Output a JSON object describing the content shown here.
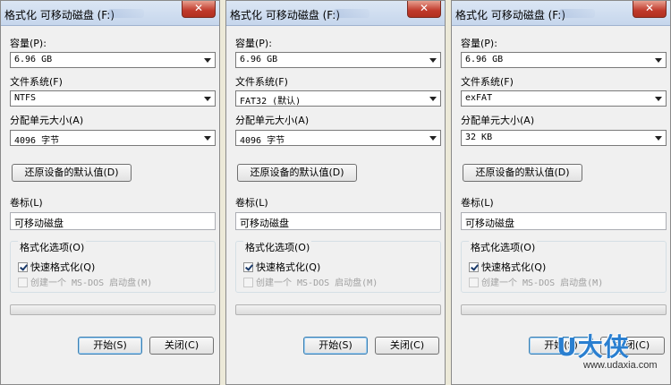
{
  "dialogs": [
    {
      "title": "格式化 可移动磁盘 (F:)",
      "capacity_label": "容量(P):",
      "capacity_value": "6.96 GB",
      "filesystem_label": "文件系统(F)",
      "filesystem_value": "NTFS",
      "alloc_label": "分配单元大小(A)",
      "alloc_value": "4096 字节",
      "restore_button": "还原设备的默认值(D)",
      "volume_label": "卷标(L)",
      "volume_value": "可移动磁盘",
      "options_legend": "格式化选项(O)",
      "quick_format": "快速格式化(Q)",
      "quick_format_checked": true,
      "msdos_disk": "创建一个 MS-DOS 启动盘(M)",
      "start_button": "开始(S)",
      "close_button": "关闭(C)"
    },
    {
      "title": "格式化 可移动磁盘 (F:)",
      "capacity_label": "容量(P):",
      "capacity_value": "6.96 GB",
      "filesystem_label": "文件系统(F)",
      "filesystem_value": "FAT32 (默认)",
      "alloc_label": "分配单元大小(A)",
      "alloc_value": "4096 字节",
      "restore_button": "还原设备的默认值(D)",
      "volume_label": "卷标(L)",
      "volume_value": "可移动磁盘",
      "options_legend": "格式化选项(O)",
      "quick_format": "快速格式化(Q)",
      "quick_format_checked": true,
      "msdos_disk": "创建一个 MS-DOS 启动盘(M)",
      "start_button": "开始(S)",
      "close_button": "关闭(C)"
    },
    {
      "title": "格式化 可移动磁盘 (F:)",
      "capacity_label": "容量(P):",
      "capacity_value": "6.96 GB",
      "filesystem_label": "文件系统(F)",
      "filesystem_value": "exFAT",
      "alloc_label": "分配单元大小(A)",
      "alloc_value": "32 KB",
      "restore_button": "还原设备的默认值(D)",
      "volume_label": "卷标(L)",
      "volume_value": "可移动磁盘",
      "options_legend": "格式化选项(O)",
      "quick_format": "快速格式化(Q)",
      "quick_format_checked": true,
      "msdos_disk": "创建一个 MS-DOS 启动盘(M)",
      "start_button": "开始(S)",
      "close_button": "关闭(C)"
    }
  ],
  "close_glyph": "✕",
  "watermark": {
    "logo": "U大侠",
    "url": "www.udaxia.com"
  }
}
